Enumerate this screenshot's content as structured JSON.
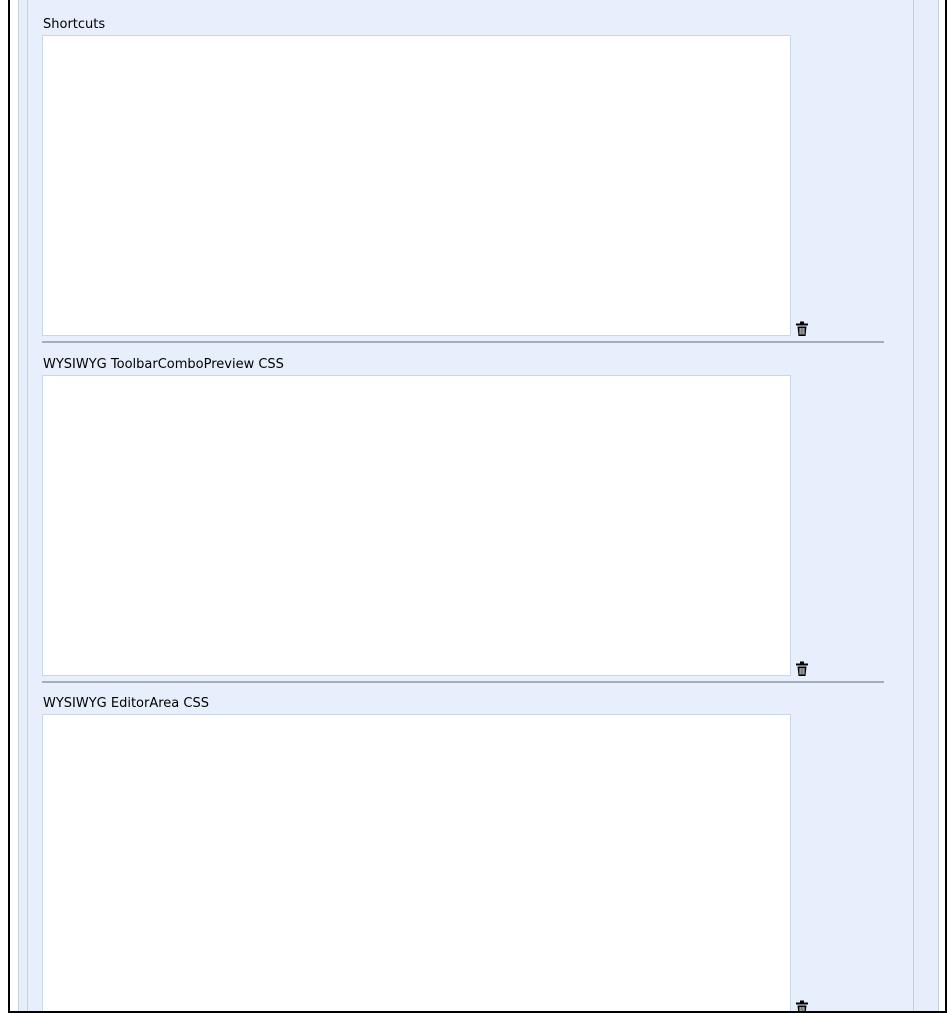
{
  "fields": [
    {
      "label": "Shortcuts",
      "value": "",
      "delete_icon": "trash-icon"
    },
    {
      "label": "WYSIWYG ToolbarComboPreview CSS",
      "value": "",
      "delete_icon": "trash-icon"
    },
    {
      "label": "WYSIWYG EditorArea CSS",
      "value": "",
      "delete_icon": "trash-icon"
    }
  ]
}
